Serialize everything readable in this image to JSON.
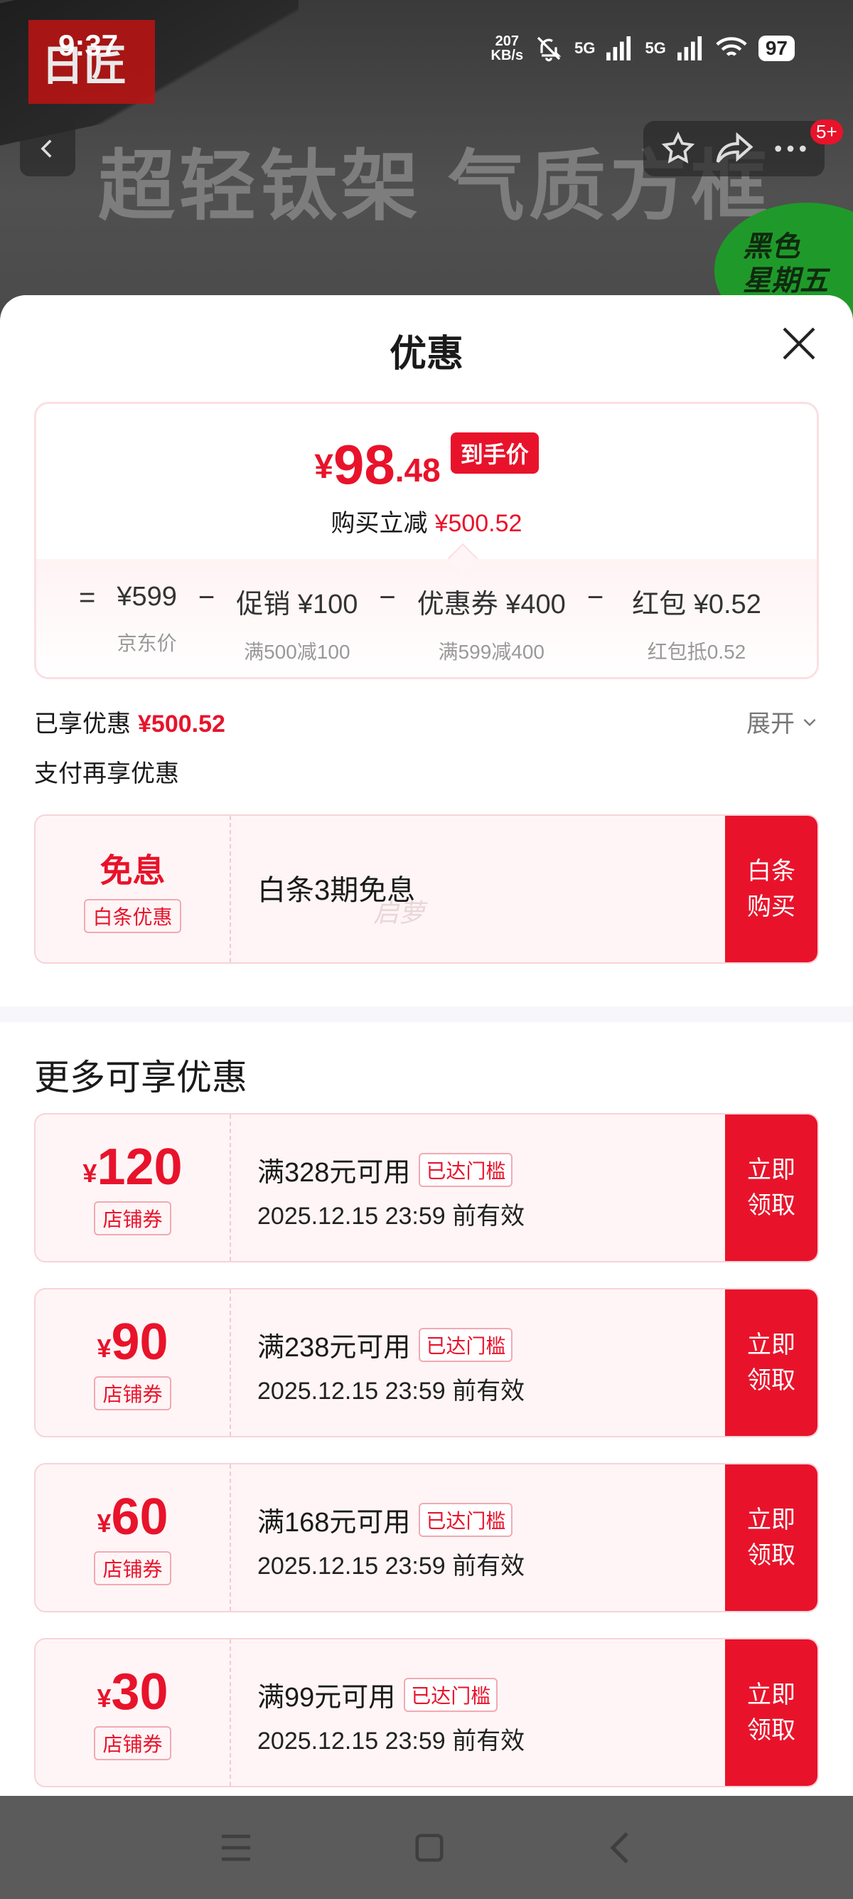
{
  "status_bar": {
    "time": "9:37",
    "speed_value": "207",
    "speed_unit": "KB/s",
    "net1": "5G",
    "net2": "5G",
    "battery": "97"
  },
  "background": {
    "logo_text": "日匠",
    "slogan": "超轻钛架 气质方框",
    "badge_line1": "黑色",
    "badge_line2": "星期五",
    "notification_badge": "5+"
  },
  "sheet": {
    "title": "优惠"
  },
  "price_card": {
    "yen": "¥",
    "price_int": "98",
    "price_dec": ".48",
    "price_tag": "到手价",
    "reduce_label": "购买立减",
    "reduce_amount": "¥500.52",
    "formula": [
      {
        "op": "=",
        "main": "¥599",
        "sub": "京东价"
      },
      {
        "op": "−",
        "main": "促销 ¥100",
        "sub": "满500减100"
      },
      {
        "op": "−",
        "main": "优惠券 ¥400",
        "sub": "满599减400"
      },
      {
        "op": "−",
        "main": "红包 ¥0.52",
        "sub": "红包抵0.52"
      }
    ]
  },
  "enjoyed": {
    "label": "已享优惠",
    "amount": "¥500.52",
    "expand_label": "展开"
  },
  "pay_more_title": "支付再享优惠",
  "free_interest": {
    "title": "免息",
    "label": "白条优惠",
    "desc": "白条3期免息",
    "watermark": "启萝",
    "action": "白条购买"
  },
  "more_title": "更多可享优惠",
  "coupons": [
    {
      "yen": "¥",
      "amount": "120",
      "label": "店铺券",
      "condition": "满328元可用",
      "reached": "已达门槛",
      "valid": "2025.12.15 23:59 前有效",
      "action": "立即领取"
    },
    {
      "yen": "¥",
      "amount": "90",
      "label": "店铺券",
      "condition": "满238元可用",
      "reached": "已达门槛",
      "valid": "2025.12.15 23:59 前有效",
      "action": "立即领取"
    },
    {
      "yen": "¥",
      "amount": "60",
      "label": "店铺券",
      "condition": "满168元可用",
      "reached": "已达门槛",
      "valid": "2025.12.15 23:59 前有效",
      "action": "立即领取"
    },
    {
      "yen": "¥",
      "amount": "30",
      "label": "店铺券",
      "condition": "满99元可用",
      "reached": "已达门槛",
      "valid": "2025.12.15 23:59 前有效",
      "action": "立即领取"
    }
  ],
  "colors": {
    "accent": "#e8132b",
    "coupon_bg": "#fff5f6"
  }
}
